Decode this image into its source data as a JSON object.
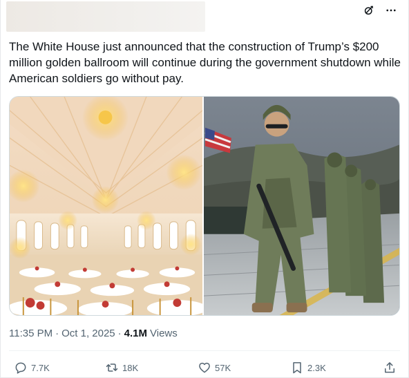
{
  "post": {
    "text": "The White House just announced that the construction of Trump’s $200 million golden ballroom will continue during the government shutdown while American soldiers go without pay.",
    "time": "11:35 PM",
    "separator1": "·",
    "date": "Oct 1, 2025",
    "separator2": "·",
    "views_count": "4.1M",
    "views_label": "Views"
  },
  "actions": {
    "replies": "7.7K",
    "reposts": "18K",
    "likes": "57K",
    "bookmarks": "2.3K"
  },
  "icons": {
    "grok": "grok-icon",
    "more": "more-icon",
    "reply": "reply-icon",
    "repost": "repost-icon",
    "like": "heart-icon",
    "bookmark": "bookmark-icon",
    "share": "share-icon"
  },
  "images": [
    {
      "subject": "golden-ballroom-rendering"
    },
    {
      "subject": "soldiers-marching"
    }
  ],
  "colors": {
    "text": "#0f1419",
    "secondary": "#536471",
    "divider": "#eff3f4"
  }
}
